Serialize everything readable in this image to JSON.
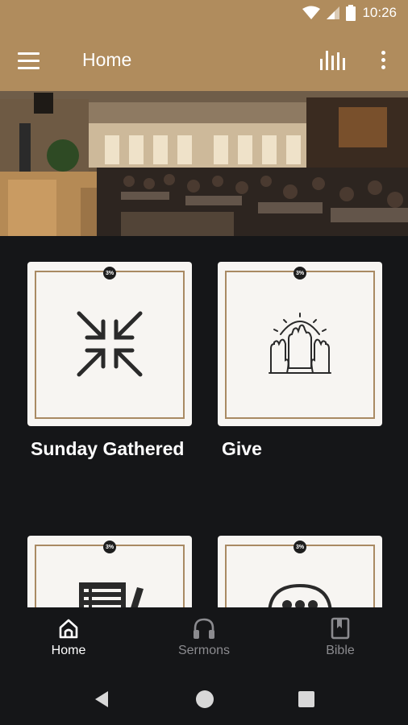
{
  "status_bar": {
    "time": "10:26"
  },
  "app_bar": {
    "title": "Home"
  },
  "tiles": [
    {
      "label": "Sunday Gathered",
      "icon": "arrows-inward-icon",
      "badge": "3%"
    },
    {
      "label": "Give",
      "icon": "raised-hands-icon",
      "badge": "3%"
    },
    {
      "label": "",
      "icon": "notes-pencil-icon",
      "badge": "3%"
    },
    {
      "label": "",
      "icon": "chat-bubble-icon",
      "badge": "3%"
    }
  ],
  "bottom_nav": {
    "items": [
      {
        "label": "Home",
        "icon": "home-icon",
        "active": true
      },
      {
        "label": "Sermons",
        "icon": "headphones-icon",
        "active": false
      },
      {
        "label": "Bible",
        "icon": "book-icon",
        "active": false
      }
    ]
  },
  "colors": {
    "accent": "#b08c5d",
    "background": "#151618",
    "tile": "#f7f5f2",
    "tile_border": "#a98a63",
    "inactive": "#8b8b8f"
  }
}
